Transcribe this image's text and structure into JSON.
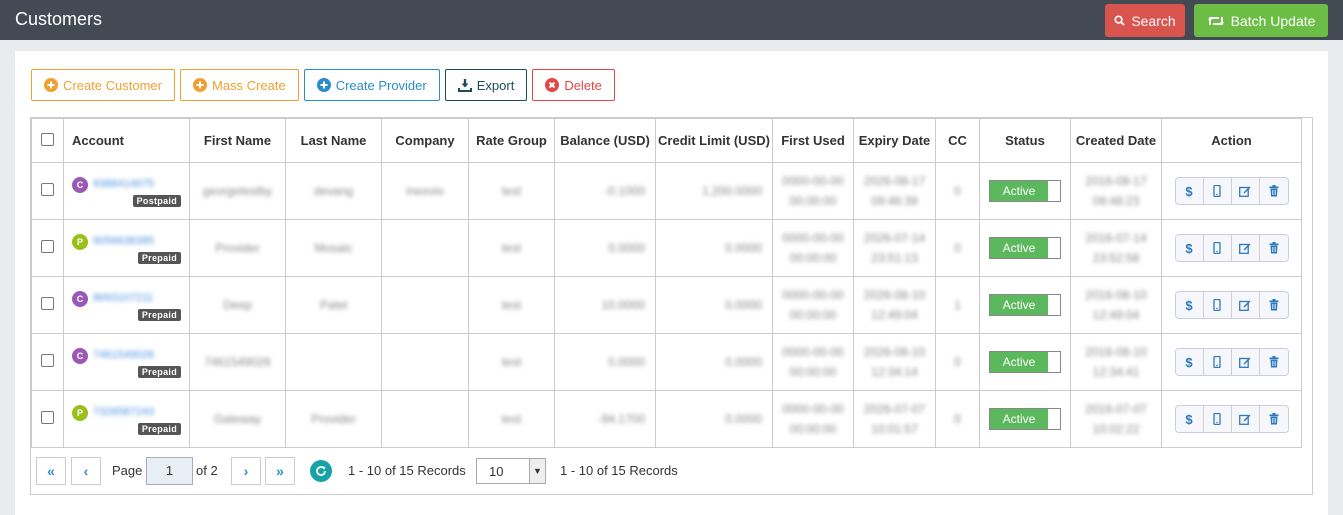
{
  "header": {
    "title": "Customers",
    "search_label": "Search",
    "batch_update_label": "Batch Update"
  },
  "toolbar": {
    "create_customer": "Create Customer",
    "mass_create": "Mass Create",
    "create_provider": "Create Provider",
    "export": "Export",
    "delete": "Delete"
  },
  "table": {
    "columns": [
      "Account",
      "First Name",
      "Last Name",
      "Company",
      "Rate Group",
      "Balance (USD)",
      "Credit Limit (USD)",
      "First Used",
      "Expiry Date",
      "CC",
      "Status",
      "Created Date",
      "Action"
    ],
    "rows": [
      {
        "avatar": "C",
        "avatar_color": "#9b59b6",
        "account": "9388414675",
        "type": "Postpaid",
        "first_name": "georgetestby",
        "last_name": "devang",
        "company": "inexvio",
        "rate_group": "test",
        "balance": "-0.1000",
        "credit_limit": "1,200.0000",
        "first_used_1": "0000-00-00",
        "first_used_2": "00:00:00",
        "expiry_1": "2026-08-17",
        "expiry_2": "09:46:39",
        "cc": "0",
        "status": "Active",
        "created_1": "2016-08-17",
        "created_2": "09:48:23"
      },
      {
        "avatar": "P",
        "avatar_color": "#9bbf1a",
        "account": "9056638385",
        "type": "Prepaid",
        "first_name": "Provider",
        "last_name": "Mosaic",
        "company": "",
        "rate_group": "test",
        "balance": "0.0000",
        "credit_limit": "0.0000",
        "first_used_1": "0000-00-00",
        "first_used_2": "00:00:00",
        "expiry_1": "2026-07-14",
        "expiry_2": "23:51:13",
        "cc": "0",
        "status": "Active",
        "created_1": "2016-07-14",
        "created_2": "23:52:58"
      },
      {
        "avatar": "C",
        "avatar_color": "#9b59b6",
        "account": "8693107211",
        "type": "Prepaid",
        "first_name": "Deep",
        "last_name": "Patel",
        "company": "",
        "rate_group": "test",
        "balance": "10.0000",
        "credit_limit": "0.0000",
        "first_used_1": "0000-00-00",
        "first_used_2": "00:00:00",
        "expiry_1": "2026-08-10",
        "expiry_2": "12:49:04",
        "cc": "1",
        "status": "Active",
        "created_1": "2016-08-10",
        "created_2": "12:49:04"
      },
      {
        "avatar": "C",
        "avatar_color": "#9b59b6",
        "account": "7461549026",
        "type": "Prepaid",
        "first_name": "7461549026",
        "last_name": "",
        "company": "",
        "rate_group": "test",
        "balance": "0.0000",
        "credit_limit": "0.0000",
        "first_used_1": "0000-00-00",
        "first_used_2": "00:00:00",
        "expiry_1": "2026-08-10",
        "expiry_2": "12:34:14",
        "cc": "0",
        "status": "Active",
        "created_1": "2016-08-10",
        "created_2": "12:34:41"
      },
      {
        "avatar": "P",
        "avatar_color": "#9bbf1a",
        "account": "7326587243",
        "type": "Prepaid",
        "first_name": "Gateway",
        "last_name": "Provider",
        "company": "",
        "rate_group": "test",
        "balance": "-94.1700",
        "credit_limit": "0.0000",
        "first_used_1": "0000-00-00",
        "first_used_2": "00:00:00",
        "expiry_1": "2026-07-07",
        "expiry_2": "10:01:57",
        "cc": "0",
        "status": "Active",
        "created_1": "2016-07-07",
        "created_2": "10:02:22"
      }
    ]
  },
  "pager": {
    "page_label": "Page",
    "page_value": "1",
    "of_label": "of 2",
    "records_left": "1 - 10 of 15 Records",
    "per_page": "10",
    "records_right": "1 - 10 of 15 Records"
  },
  "colors": {
    "topbar": "#434a54",
    "search": "#d9534f",
    "batch": "#6cbd45",
    "active": "#5cb85c"
  }
}
